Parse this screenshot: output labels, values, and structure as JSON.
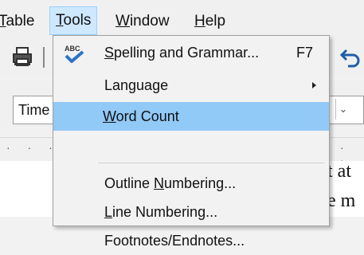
{
  "menubar": {
    "table": {
      "pre": "",
      "acc": "T",
      "post": "able"
    },
    "tools": {
      "pre": "",
      "acc": "T",
      "post": "ools"
    },
    "window": {
      "pre": "",
      "acc": "W",
      "post": "indow"
    },
    "help": {
      "pre": "",
      "acc": "H",
      "post": "elp"
    }
  },
  "formatting": {
    "font_name": "Time"
  },
  "document": {
    "line1": "t at",
    "line2": "e m"
  },
  "tools_menu": {
    "items": [
      {
        "icon": "spellcheck-abc-icon",
        "acc": "S",
        "post": "pelling and Grammar...",
        "shortcut": "F7"
      },
      {
        "pre": "Language",
        "submenu": true
      },
      {
        "acc": "W",
        "post": "ord Count",
        "highlighted": true
      },
      {
        "pre": "Outline ",
        "acc": "N",
        "post": "umbering..."
      },
      {
        "acc": "L",
        "post": "ine Numbering..."
      },
      {
        "pre": "Footnotes/Endnotes..."
      }
    ]
  },
  "colors": {
    "highlight": "#91c9f7",
    "menubar_active": "#cde8ff",
    "menu_bg": "#f2f2f2"
  }
}
